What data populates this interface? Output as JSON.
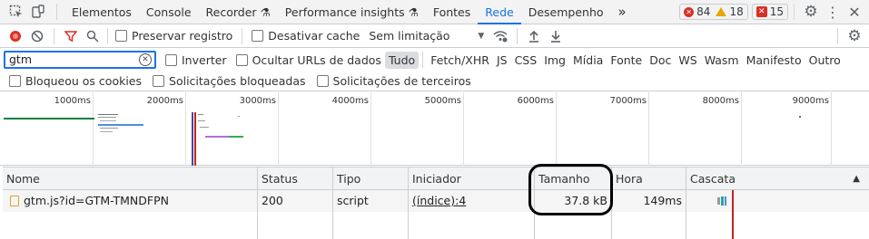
{
  "tabs": {
    "items": [
      "Elementos",
      "Console",
      "Recorder",
      "Performance insights",
      "Fontes",
      "Rede",
      "Desempenho"
    ],
    "active": "Rede",
    "more_label": "»"
  },
  "issues": {
    "errors": "84",
    "warnings": "18",
    "blocked": "15"
  },
  "toolbar": {
    "preserve_log": "Preservar registro",
    "disable_cache": "Desativar cache",
    "throttling": "Sem limitação"
  },
  "filter": {
    "value": "gtm",
    "invert": "Inverter",
    "hide_data_urls": "Ocultar URLs de dados",
    "types": [
      "Tudo",
      "Fetch/XHR",
      "JS",
      "CSS",
      "Img",
      "Mídia",
      "Fonte",
      "Doc",
      "WS",
      "Wasm",
      "Manifesto",
      "Outro"
    ],
    "active_type": "Tudo"
  },
  "options": {
    "blocked_cookies": "Bloqueou os cookies",
    "blocked_requests": "Solicitações bloqueadas",
    "third_party": "Solicitações de terceiros"
  },
  "overview": {
    "ticks": [
      "1000ms",
      "2000ms",
      "3000ms",
      "4000ms",
      "5000ms",
      "6000ms",
      "7000ms",
      "8000ms",
      "9000ms"
    ]
  },
  "table": {
    "columns": {
      "name": "Nome",
      "status": "Status",
      "type": "Tipo",
      "initiator": "Iniciador",
      "size": "Tamanho",
      "time": "Hora",
      "waterfall": "Cascata"
    },
    "rows": [
      {
        "name": "gtm.js?id=GTM-TMNDFPN",
        "status": "200",
        "type": "script",
        "initiator": "(índice):4",
        "size": "37.8 kB",
        "time": "149ms"
      }
    ]
  },
  "colors": {
    "accent": "#1a73e8",
    "error": "#d93025",
    "warning": "#e8a600"
  }
}
